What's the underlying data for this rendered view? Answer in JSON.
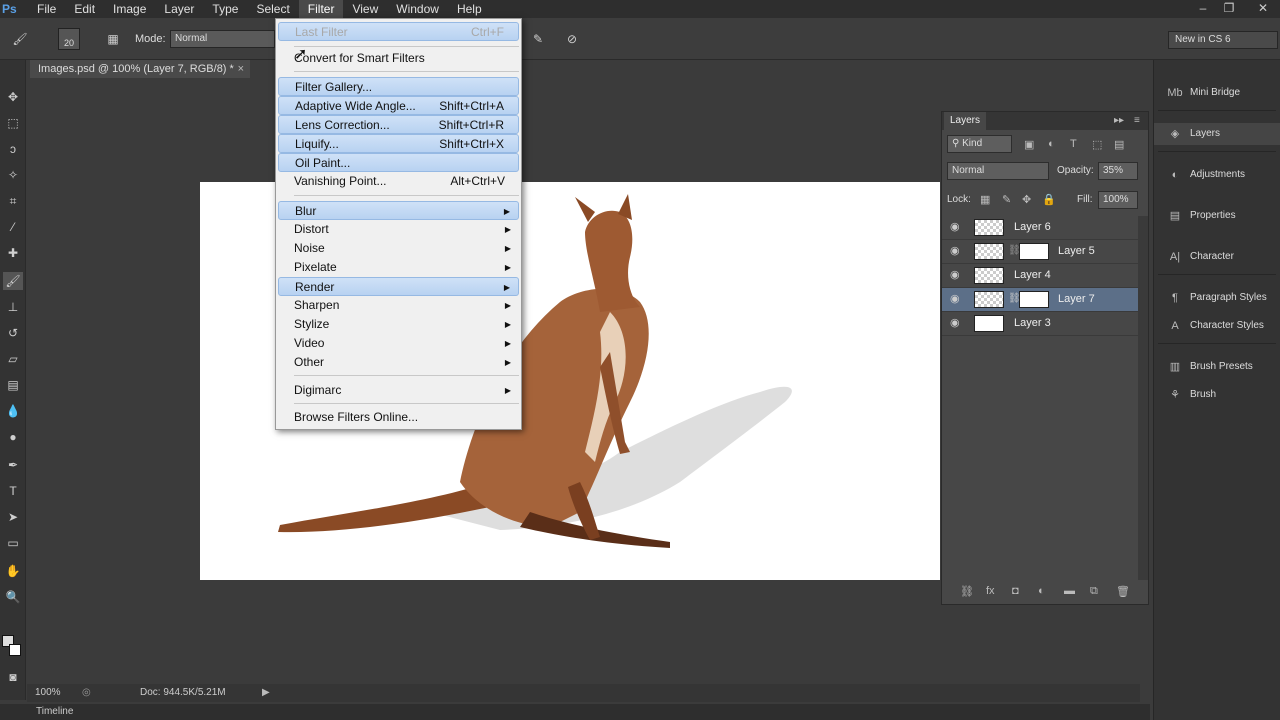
{
  "app": {
    "logo": "Ps",
    "menu": [
      "File",
      "Edit",
      "Image",
      "Layer",
      "Type",
      "Select",
      "Filter",
      "View",
      "Window",
      "Help"
    ],
    "active_menu": "Filter",
    "window_controls": [
      "minimize",
      "restore",
      "close"
    ]
  },
  "options_bar": {
    "brush_size": "20",
    "mode_label": "Mode:",
    "mode_value": "Normal"
  },
  "workspace": {
    "value": "New in CS 6"
  },
  "document": {
    "tab_title": "Images.psd @ 100% (Layer 7, RGB/8) *",
    "close": "×"
  },
  "filter_menu": {
    "items": [
      {
        "label": "Last Filter",
        "shortcut": "Ctrl+F",
        "disabled": true
      },
      {
        "label": "Convert for Smart Filters",
        "shortcut": ""
      },
      {
        "label": "Filter Gallery...",
        "shortcut": ""
      },
      {
        "label": "Adaptive Wide Angle...",
        "shortcut": "Shift+Ctrl+A"
      },
      {
        "label": "Lens Correction...",
        "shortcut": "Shift+Ctrl+R"
      },
      {
        "label": "Liquify...",
        "shortcut": "Shift+Ctrl+X"
      },
      {
        "label": "Oil Paint...",
        "shortcut": ""
      },
      {
        "label": "Vanishing Point...",
        "shortcut": "Alt+Ctrl+V"
      },
      {
        "label": "Blur",
        "submenu": true
      },
      {
        "label": "Distort",
        "submenu": true
      },
      {
        "label": "Noise",
        "submenu": true
      },
      {
        "label": "Pixelate",
        "submenu": true
      },
      {
        "label": "Render",
        "submenu": true
      },
      {
        "label": "Sharpen",
        "submenu": true
      },
      {
        "label": "Stylize",
        "submenu": true
      },
      {
        "label": "Video",
        "submenu": true
      },
      {
        "label": "Other",
        "submenu": true
      },
      {
        "label": "Digimarc",
        "submenu": true
      },
      {
        "label": "Browse Filters Online...",
        "shortcut": ""
      }
    ]
  },
  "layers_panel": {
    "title": "Layers",
    "kind_filter": "Kind",
    "blend_mode": "Normal",
    "opacity_label": "Opacity:",
    "opacity_value": "35%",
    "lock_label": "Lock:",
    "fill_label": "Fill:",
    "fill_value": "100%",
    "layers": [
      {
        "name": "Layer 6",
        "has_mask": false,
        "selected": false
      },
      {
        "name": "Layer 5",
        "has_mask": true,
        "selected": false
      },
      {
        "name": "Layer 4",
        "has_mask": false,
        "selected": false
      },
      {
        "name": "Layer 7",
        "has_mask": true,
        "selected": true
      },
      {
        "name": "Layer 3",
        "has_mask": false,
        "selected": false
      }
    ]
  },
  "dock": {
    "items": [
      "Mini Bridge",
      "Layers",
      "Adjustments",
      "Properties",
      "Character",
      "Paragraph Styles",
      "Character Styles",
      "Brush Presets",
      "Brush"
    ],
    "active": "Layers"
  },
  "status_bar": {
    "zoom": "100%",
    "doc_info": "Doc: 944.5K/5.21M"
  },
  "timeline": {
    "label": "Timeline"
  },
  "colors": {
    "menu_highlight": "#b8d2f1",
    "selected_layer": "#5c6f88",
    "ui_dark": "#3b3b3b"
  }
}
